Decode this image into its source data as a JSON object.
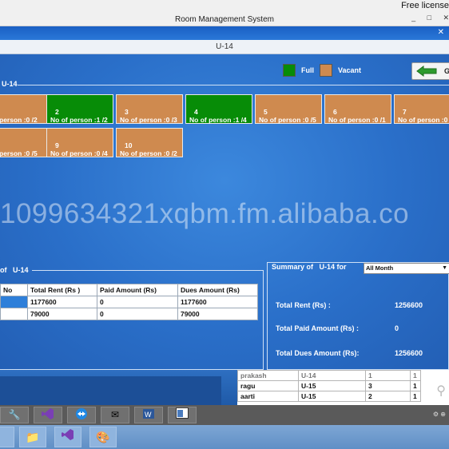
{
  "window": {
    "title": "Room Management System",
    "license_text": "Free license",
    "inner_title": "U-14",
    "controls": [
      "_",
      "□",
      "✕"
    ],
    "close_glyph": "✕"
  },
  "legend": {
    "full_label": "Full",
    "vacant_label": "Vacant",
    "full_color": "#078c07",
    "vacant_color": "#cf8a4f"
  },
  "go_button": {
    "label": "G",
    "icon": "back-arrow-icon"
  },
  "section_label": "U-14",
  "rooms": [
    {
      "number": "",
      "status": "vacant",
      "persons": "person :0 /2"
    },
    {
      "number": "2",
      "status": "full",
      "persons": "No of person :1 /2"
    },
    {
      "number": "3",
      "status": "vacant",
      "persons": "No of person :0 /3"
    },
    {
      "number": "4",
      "status": "full",
      "persons": "No of person :1 /4"
    },
    {
      "number": "5",
      "status": "vacant",
      "persons": "No of person :0 /5"
    },
    {
      "number": "6",
      "status": "vacant",
      "persons": "No of person :0 /1"
    },
    {
      "number": "7",
      "status": "vacant",
      "persons": "No of person :0"
    },
    {
      "number": "",
      "status": "vacant",
      "persons": "person :0 /5"
    },
    {
      "number": "9",
      "status": "vacant",
      "persons": "No of person :0 /4"
    },
    {
      "number": "10",
      "status": "vacant",
      "persons": "No of person :0 /2"
    }
  ],
  "watermark": "1099634321xqbm.fm.alibaba.co",
  "left_panel": {
    "header_prefix": "of",
    "header_room": "U-14",
    "columns": [
      "No",
      "Total Rent (Rs )",
      "Paid Amount (Rs)",
      "Dues Amount (Rs)"
    ],
    "rows": [
      [
        "",
        "1177600",
        "0",
        "1177600"
      ],
      [
        "",
        "79000",
        "0",
        "79000"
      ]
    ]
  },
  "summary": {
    "header": "Summary of",
    "room": "U-14 for",
    "period": "All Month",
    "total_rent_label": "Total Rent (Rs) :",
    "total_rent": "1256600",
    "total_paid_label": "Total Paid Amount (Rs) :",
    "total_paid": "0",
    "total_dues_label": "Total Dues Amount (Rs):",
    "total_dues": "1256600"
  },
  "background_table": {
    "rows": [
      [
        "prakash",
        "U-14",
        "1",
        "1"
      ],
      [
        "ragu",
        "U-15",
        "3",
        "1"
      ],
      [
        "aarti",
        "U-15",
        "2",
        "1"
      ]
    ]
  },
  "taskbar": {
    "apps": [
      "tools-icon",
      "visual-studio-icon",
      "teamviewer-icon",
      "mail-icon",
      "word-icon",
      "window-icon"
    ],
    "bottom_apps": [
      "start-icon",
      "folder-icon",
      "visual-studio-icon",
      "paint-icon"
    ]
  }
}
